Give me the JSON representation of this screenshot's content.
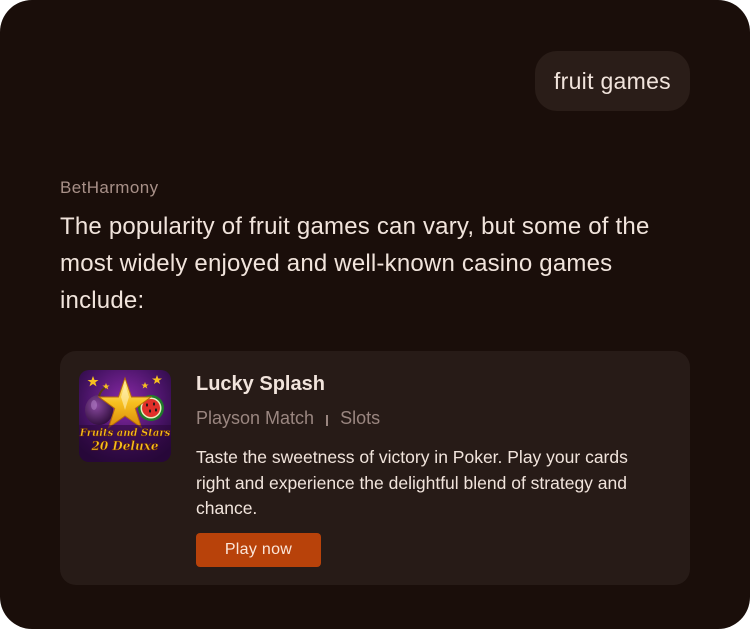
{
  "user_message": "fruit games",
  "assistant": {
    "name": "BetHarmony",
    "reply": "The popularity of fruit games can vary, but some of the most widely enjoyed and well-known casino games include:"
  },
  "game_card": {
    "thumbnail": {
      "icon": "fruits-and-stars-thumbnail",
      "line1": "Fruits and Stars",
      "line2": "20 Deluxe"
    },
    "title": "Lucky Splash",
    "provider": "Playson Match",
    "category": "Slots",
    "description": "Taste the sweetness of victory in Poker. Play your cards right and experience the delightful blend of strategy and chance.",
    "button_label": "Play now"
  },
  "colors": {
    "background": "#1a0e0a",
    "card": "#271b17",
    "bubble": "#2a1d18",
    "accent": "#b8420a",
    "text": "#f1e4dc",
    "muted": "#9a8680"
  }
}
